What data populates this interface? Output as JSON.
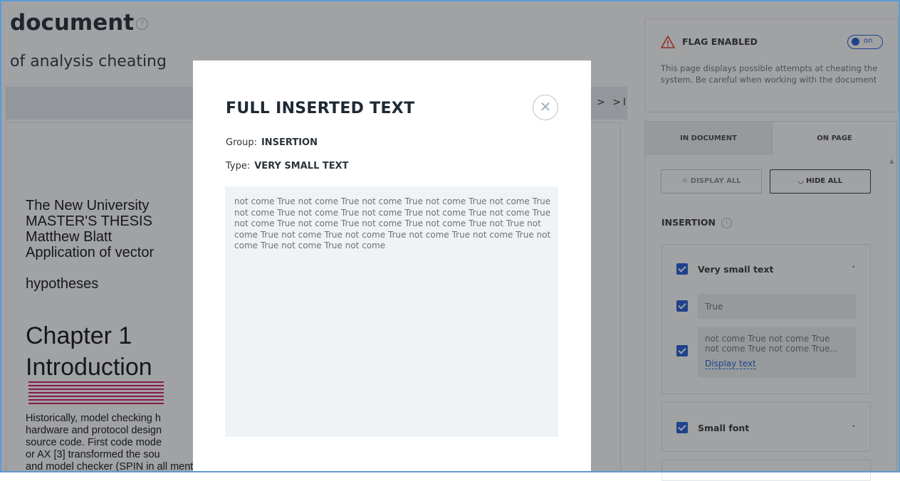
{
  "document": {
    "title": "document",
    "help_icon": "question-circle-icon",
    "subtitle": "of analysis cheating",
    "nav": "> >I",
    "lines": [
      "The New University",
      "MASTER'S THESIS",
      "Matthew Blatt",
      "Application of vector",
      "hypotheses"
    ],
    "chapter": [
      "Chapter 1",
      "Introduction"
    ],
    "body": [
      "Historically, model checking h",
      "hardware and protocol design",
      "source code. First code mode",
      "or AX [3] transformed the sou",
      "and model checker (SPIN in all mentioned examples). The drawback of the"
    ]
  },
  "flag": {
    "icon": "warning-triangle-icon",
    "title": "FLAG ENABLED",
    "toggle_label": "on",
    "description": "This page displays possible attempts at cheating the system. Be careful when working with the document"
  },
  "tabs": [
    "IN DOCUMENT",
    "ON PAGE"
  ],
  "actions": {
    "display_all": "DISPLAY ALL",
    "hide_all": "HIDE ALL"
  },
  "insertion": {
    "title": "INSERTION",
    "groups": [
      {
        "label": "Very small text",
        "expanded": true,
        "items": [
          {
            "text": "True"
          },
          {
            "text_line1": "not come True not come True",
            "text_line2": "not come True not come True...",
            "link": "Display text"
          }
        ]
      },
      {
        "label": "Small font",
        "expanded": false
      }
    ]
  },
  "modal": {
    "title": "FULL INSERTED TEXT",
    "group_label": "Group:",
    "group_value": "INSERTION",
    "type_label": "Type:",
    "type_value": "VERY SMALL TEXT",
    "text": "not come True not come True not come True not come True not come True not come True not come True not come True not come True not come True not come True not come True not come True not come True not True not come True not come True not come True not come True not come True not come True not come True not come"
  },
  "colors": {
    "accent": "#1f5bd4",
    "highlight": "#d3146a",
    "frame": "#5b9bd5"
  }
}
